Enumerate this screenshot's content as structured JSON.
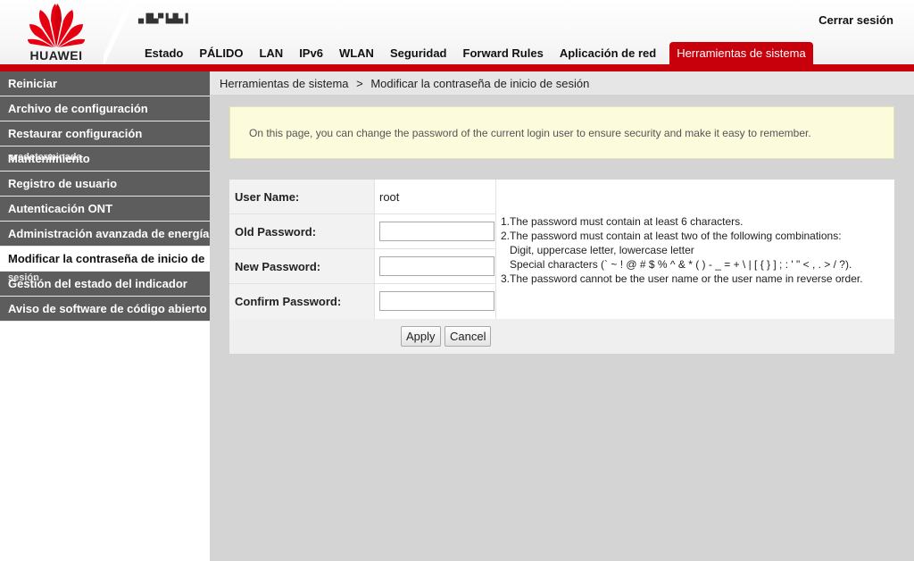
{
  "header": {
    "brand": "HUAWEI",
    "model": "▄▐█▄▀▐▄█▄▐",
    "logout": "Cerrar sesión",
    "brand_color": "#c7000b",
    "nav": [
      {
        "label": "Estado"
      },
      {
        "label": "PÁLIDO"
      },
      {
        "label": "LAN"
      },
      {
        "label": "IPv6"
      },
      {
        "label": "WLAN"
      },
      {
        "label": "Seguridad"
      },
      {
        "label": "Forward Rules"
      },
      {
        "label": "Aplicación de red"
      },
      {
        "label": "Herramientas de sistema"
      }
    ]
  },
  "sidebar": {
    "items": [
      {
        "label": "Reiniciar"
      },
      {
        "label": "Archivo de configuración"
      },
      {
        "label": "Restaurar configuración"
      },
      {
        "label": "Mantenimiento",
        "overlap": "predeterminada"
      },
      {
        "label": "Registro de usuario"
      },
      {
        "label": "Autenticación ONT"
      },
      {
        "label": "Administración avanzada de energía"
      },
      {
        "label": "Modificar la contraseña de inicio de"
      },
      {
        "label": "Gestión del estado del indicador",
        "overlap": "sesión"
      },
      {
        "label": "Aviso de software de código abierto"
      }
    ]
  },
  "breadcrumb": {
    "parent": "Herramientas de sistema",
    "separator": ">",
    "current": "Modificar la contraseña de inicio de sesión"
  },
  "note": "On this page, you can change the password of the current login user to ensure security and make it easy to remember.",
  "form": {
    "user_name_label": "User Name:",
    "user_name_value": "root",
    "old_password_label": "Old Password:",
    "old_password_value": "",
    "new_password_label": "New Password:",
    "new_password_value": "",
    "confirm_password_label": "Confirm Password:",
    "confirm_password_value": ""
  },
  "rules": {
    "line1": "1.The password must contain at least 6 characters.",
    "line2": "2.The password must contain at least two of the following combinations:",
    "line3": "Digit, uppercase letter, lowercase letter",
    "line4": "Special characters (` ~ ! @ # $ % ^ & * ( ) - _ = + \\ | [ { } ] ; : ' \" < , . > / ?).",
    "line5": "3.The password cannot be the user name or the user name in reverse order."
  },
  "buttons": {
    "apply": "Apply",
    "cancel": "Cancel"
  }
}
